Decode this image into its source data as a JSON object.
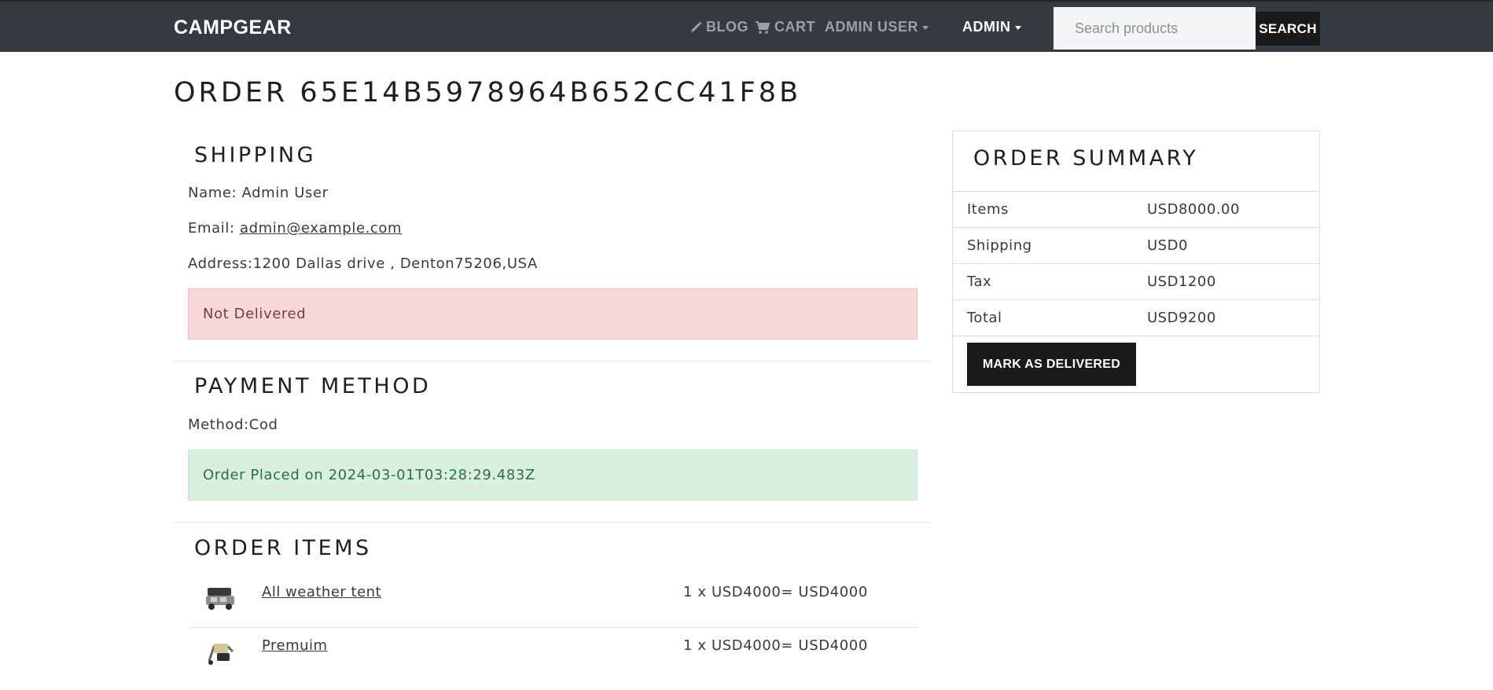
{
  "navbar": {
    "brand": "CAMPGEAR",
    "blog_label": "BLOG",
    "cart_label": "CART",
    "user_menu_label": "ADMIN USER",
    "admin_menu_label": "ADMIN",
    "search_placeholder": "Search products",
    "search_button": "SEARCH"
  },
  "page": {
    "title": "ORDER 65E14B5978964B652CC41F8B"
  },
  "shipping": {
    "heading": "SHIPPING",
    "name_label": "Name:",
    "name": "Admin User",
    "email_label": "Email:",
    "email": "admin@example.com",
    "address_label": "Address:",
    "address": "1200 Dallas drive , Denton75206,USA",
    "status": "Not Delivered"
  },
  "payment": {
    "heading": "PAYMENT METHOD",
    "method_label": "Method:",
    "method": "Cod",
    "status": "Order Placed on 2024-03-01T03:28:29.483Z"
  },
  "order_items": {
    "heading": "ORDER ITEMS",
    "items": [
      {
        "name": "All weather tent",
        "price_line": "1 x USD4000= USD4000",
        "icon": "tent-product-image"
      },
      {
        "name": "Premuim",
        "price_line": "1 x USD4000= USD4000",
        "icon": "gear-product-image"
      }
    ]
  },
  "summary": {
    "heading": "ORDER SUMMARY",
    "rows": [
      {
        "label": "Items",
        "value": "USD8000.00"
      },
      {
        "label": "Shipping",
        "value": "USD0"
      },
      {
        "label": "Tax",
        "value": "USD1200"
      },
      {
        "label": "Total",
        "value": "USD9200"
      }
    ],
    "deliver_button": "MARK AS DELIVERED"
  },
  "colors": {
    "navbar_bg": "#343a40",
    "danger_bg": "#f8d9da",
    "success_bg": "#d9f0e1",
    "button_bg": "#1a1a1a"
  }
}
